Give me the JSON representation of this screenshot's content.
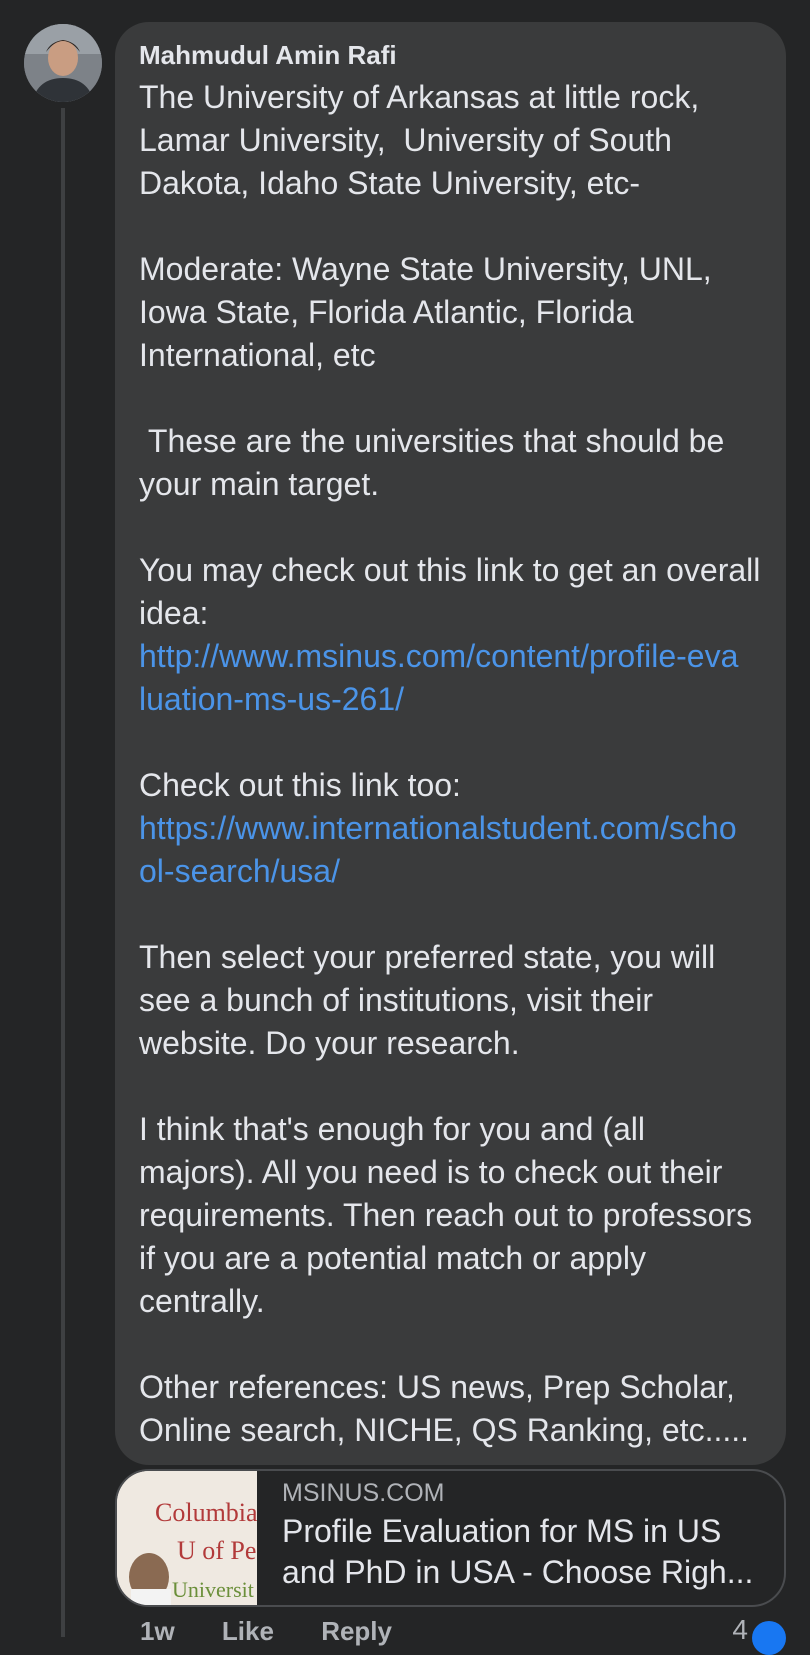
{
  "comment": {
    "author": "Mahmudul Amin Rafi",
    "paragraphs": [
      "The University of Arkansas at little rock, Lamar University,  University of South Dakota, Idaho State University, etc-",
      "Moderate: Wayne State University, UNL, Iowa State, Florida Atlantic, Florida International, etc",
      " These are the universities that should be your main target.",
      "You may check out this link to get an overall idea:",
      "Check out this link too:",
      "Then select your preferred state, you will see a bunch of institutions, visit their website. Do your research.",
      "I think that's enough for you and (all majors). All you need is to check out their requirements. Then reach out to professors if you are a potential match or apply centrally.",
      "Other references: US news, Prep Scholar, Online search, NICHE, QS Ranking, etc....."
    ],
    "links": [
      "http://www.msinus.com/content/profile-evaluation-ms-us-261/",
      "https://www.internationalstudent.com/school-search/usa/"
    ]
  },
  "link_preview": {
    "domain": "MSINUS.COM",
    "title": "Profile Evaluation for MS in US and PhD in USA - Choose Righ..."
  },
  "thumbnail_text": [
    "Columbia Un",
    "U of Pe",
    "Universit"
  ],
  "actions": {
    "time": "1w",
    "like": "Like",
    "reply": "Reply"
  },
  "reaction_count": "4",
  "colors": {
    "background": "#242526",
    "bubble": "#3a3b3c",
    "link": "#4b94e8",
    "like_badge": "#1877f2"
  }
}
